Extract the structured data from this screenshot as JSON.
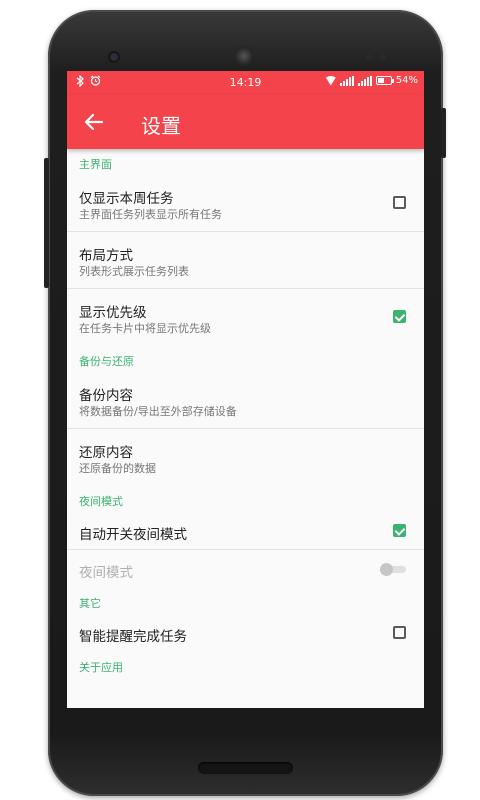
{
  "status_bar": {
    "time": "14:19",
    "battery": "54%",
    "battery_level": 0.54,
    "left_icons": [
      "bluetooth-icon",
      "alarm-icon"
    ],
    "right_icons": [
      "wifi-icon",
      "signal-icon",
      "signal-icon",
      "battery-icon"
    ]
  },
  "toolbar": {
    "back_icon": "arrow-left-icon",
    "title": "设置",
    "color": "#f4434b"
  },
  "accent_color": "#3cb371",
  "sections": {
    "main": {
      "header": "主界面",
      "items": [
        {
          "title": "仅显示本周任务",
          "summary": "主界面任务列表显示所有任务",
          "checked": false
        },
        {
          "title": "布局方式",
          "summary": "列表形式展示任务列表"
        },
        {
          "title": "显示优先级",
          "summary": "在任务卡片中将显示优先级",
          "checked": true
        }
      ]
    },
    "backup": {
      "header": "备份与还原",
      "items": [
        {
          "title": "备份内容",
          "summary": "将数据备份/导出至外部存储设备"
        },
        {
          "title": "还原内容",
          "summary": "还原备份的数据"
        }
      ]
    },
    "night": {
      "header": "夜间模式",
      "items": [
        {
          "title": "自动开关夜间模式",
          "checked": true
        },
        {
          "title": "夜间模式",
          "enabled": false,
          "on": false
        }
      ]
    },
    "other": {
      "header": "其它",
      "items": [
        {
          "title": "智能提醒完成任务",
          "checked": false
        }
      ]
    },
    "about": {
      "header": "关于应用"
    }
  }
}
